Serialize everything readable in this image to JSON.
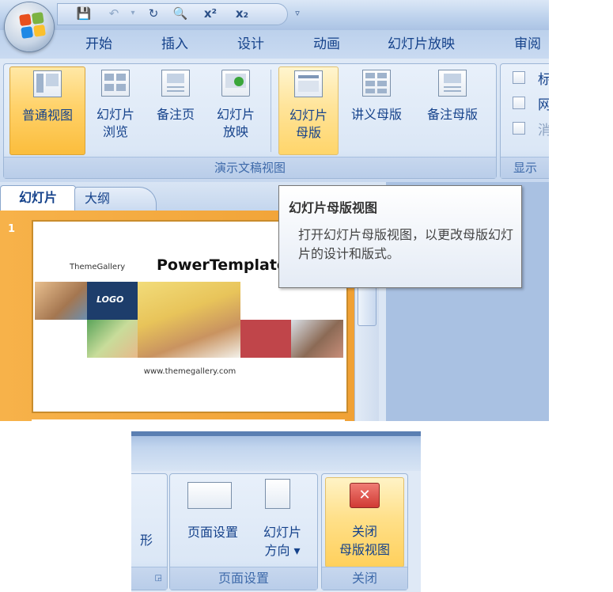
{
  "ribbon_tabs": [
    "开始",
    "插入",
    "设计",
    "动画",
    "幻灯片放映",
    "审阅"
  ],
  "view_group": {
    "buttons": [
      {
        "line1": "普通视图",
        "line2": ""
      },
      {
        "line1": "幻灯片",
        "line2": "浏览"
      },
      {
        "line1": "备注页",
        "line2": ""
      },
      {
        "line1": "幻灯片",
        "line2": "放映"
      },
      {
        "line1": "幻灯片",
        "line2": "母版"
      },
      {
        "line1": "讲义母版",
        "line2": ""
      },
      {
        "line1": "备注母版",
        "line2": ""
      }
    ],
    "label": "演示文稿视图"
  },
  "show_group": {
    "checkbox_labels": [
      "标",
      "网",
      "消"
    ],
    "label": "显示"
  },
  "pane_tabs": {
    "slides": "幻灯片",
    "outline": "大纲"
  },
  "slide": {
    "number": "1",
    "brand_small": "ThemeGallery",
    "brand_big": "PowerTemplate",
    "logo": "LOGO",
    "url": "www.themegallery.com"
  },
  "tooltip": {
    "title": "幻灯片母版视图",
    "body": "打开幻灯片母版视图，以更改母版幻灯片的设计和版式。"
  },
  "bottom": {
    "partial_label": "形",
    "page_setup_button": "页面设置",
    "orientation_line1": "幻灯片",
    "orientation_line2": "方向 ▾",
    "page_setup_group": "页面设置",
    "close_line1": "关闭",
    "close_line2": "母版视图",
    "close_group": "关闭"
  },
  "colors": {
    "ribbon_text": "#15428b",
    "active_button": "#ffd26a",
    "slide_border_orange": "#f0a135",
    "close_red": "#d03b34"
  }
}
